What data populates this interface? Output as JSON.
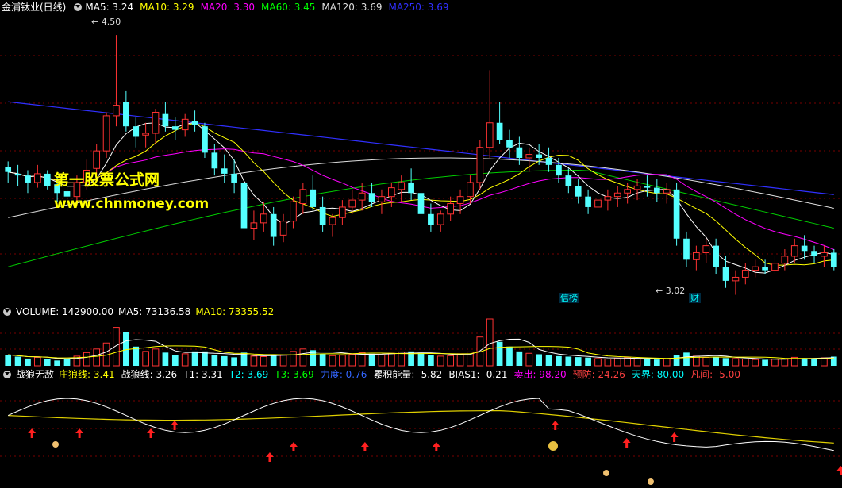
{
  "price_header": {
    "title": "金浦钛业(日线)",
    "ma": [
      {
        "label": "MA5: 3.24",
        "color": "#ffffff"
      },
      {
        "label": "MA10: 3.29",
        "color": "#ffff00"
      },
      {
        "label": "MA20: 3.30",
        "color": "#ff00ff"
      },
      {
        "label": "MA60: 3.45",
        "color": "#00ff00"
      },
      {
        "label": "MA120: 3.69",
        "color": "#dddddd"
      },
      {
        "label": "MA250: 3.69",
        "color": "#3030ff"
      }
    ]
  },
  "annotations": {
    "high": "4.50",
    "low": "3.02",
    "tag1": "信榜",
    "tag2": "财"
  },
  "watermark": {
    "line1": "第一股票公式网",
    "line2": "www.chnmoney.com"
  },
  "volume_header": {
    "label": "VOLUME: 142900.00",
    "ma5": "MA5: 73136.58",
    "ma10": "MA10: 73355.52"
  },
  "indicator_header": {
    "name": "战狼无敌",
    "items": [
      {
        "label": "庄狼线: 3.41",
        "color": "#ffff00"
      },
      {
        "label": "战狼线: 3.26",
        "color": "#ffffff"
      },
      {
        "label": "T1: 3.31",
        "color": "#ffffff"
      },
      {
        "label": "T2: 3.69",
        "color": "#00ffff"
      },
      {
        "label": "T3: 3.69",
        "color": "#00ff00"
      },
      {
        "label": "力度: 0.76",
        "color": "#3366ff"
      },
      {
        "label": "累积能量: -5.82",
        "color": "#ffffff"
      },
      {
        "label": "BIAS1: -0.21",
        "color": "#ffffff"
      },
      {
        "label": "卖出: 98.20",
        "color": "#ff00ff"
      },
      {
        "label": "预防: 24.26",
        "color": "#ff4040"
      },
      {
        "label": "天界: 80.00",
        "color": "#00ffff"
      },
      {
        "label": "凡间: -5.00",
        "color": "#ff4040"
      }
    ]
  },
  "colors": {
    "up": "#ff3232",
    "down": "#54ffff",
    "grid": "#7a0000"
  },
  "chart_data": {
    "type": "candlestick",
    "ohlc": [
      [
        3.75,
        3.78,
        3.66,
        3.72
      ],
      [
        3.71,
        3.76,
        3.64,
        3.7
      ],
      [
        3.7,
        3.73,
        3.6,
        3.66
      ],
      [
        3.66,
        3.76,
        3.63,
        3.71
      ],
      [
        3.71,
        3.73,
        3.62,
        3.64
      ],
      [
        3.65,
        3.69,
        3.55,
        3.6
      ],
      [
        3.61,
        3.64,
        3.5,
        3.58
      ],
      [
        3.58,
        3.7,
        3.55,
        3.66
      ],
      [
        3.66,
        3.79,
        3.62,
        3.73
      ],
      [
        3.74,
        3.88,
        3.7,
        3.84
      ],
      [
        3.84,
        4.06,
        3.8,
        4.04
      ],
      [
        4.04,
        4.5,
        3.98,
        4.1
      ],
      [
        4.12,
        4.18,
        3.95,
        3.98
      ],
      [
        3.98,
        4.03,
        3.86,
        3.92
      ],
      [
        3.93,
        4.0,
        3.86,
        3.94
      ],
      [
        3.94,
        4.08,
        3.88,
        4.06
      ],
      [
        4.05,
        4.12,
        3.95,
        3.98
      ],
      [
        3.98,
        4.03,
        3.9,
        3.96
      ],
      [
        3.96,
        4.05,
        3.92,
        4.02
      ],
      [
        4.01,
        4.07,
        3.95,
        3.99
      ],
      [
        3.98,
        4.0,
        3.8,
        3.83
      ],
      [
        3.83,
        3.88,
        3.7,
        3.74
      ],
      [
        3.74,
        3.82,
        3.66,
        3.71
      ],
      [
        3.71,
        3.79,
        3.6,
        3.66
      ],
      [
        3.66,
        3.7,
        3.35,
        3.4
      ],
      [
        3.4,
        3.5,
        3.33,
        3.43
      ],
      [
        3.43,
        3.55,
        3.38,
        3.48
      ],
      [
        3.48,
        3.52,
        3.3,
        3.35
      ],
      [
        3.36,
        3.48,
        3.32,
        3.44
      ],
      [
        3.44,
        3.58,
        3.4,
        3.55
      ],
      [
        3.54,
        3.66,
        3.48,
        3.62
      ],
      [
        3.62,
        3.7,
        3.5,
        3.52
      ],
      [
        3.52,
        3.58,
        3.38,
        3.42
      ],
      [
        3.42,
        3.48,
        3.35,
        3.46
      ],
      [
        3.46,
        3.56,
        3.42,
        3.52
      ],
      [
        3.52,
        3.62,
        3.48,
        3.56
      ],
      [
        3.56,
        3.66,
        3.5,
        3.6
      ],
      [
        3.6,
        3.66,
        3.52,
        3.55
      ],
      [
        3.55,
        3.62,
        3.48,
        3.58
      ],
      [
        3.58,
        3.66,
        3.52,
        3.63
      ],
      [
        3.62,
        3.7,
        3.55,
        3.66
      ],
      [
        3.66,
        3.74,
        3.56,
        3.6
      ],
      [
        3.6,
        3.66,
        3.45,
        3.48
      ],
      [
        3.48,
        3.54,
        3.38,
        3.42
      ],
      [
        3.42,
        3.5,
        3.38,
        3.48
      ],
      [
        3.48,
        3.58,
        3.44,
        3.54
      ],
      [
        3.54,
        3.62,
        3.48,
        3.58
      ],
      [
        3.58,
        3.7,
        3.54,
        3.66
      ],
      [
        3.66,
        3.9,
        3.62,
        3.86
      ],
      [
        3.86,
        4.3,
        3.8,
        4.0
      ],
      [
        4.0,
        4.12,
        3.88,
        3.9
      ],
      [
        3.9,
        3.96,
        3.8,
        3.86
      ],
      [
        3.86,
        3.92,
        3.76,
        3.8
      ],
      [
        3.8,
        3.86,
        3.72,
        3.82
      ],
      [
        3.82,
        3.88,
        3.76,
        3.8
      ],
      [
        3.8,
        3.86,
        3.72,
        3.76
      ],
      [
        3.76,
        3.8,
        3.66,
        3.7
      ],
      [
        3.7,
        3.74,
        3.6,
        3.64
      ],
      [
        3.64,
        3.68,
        3.54,
        3.58
      ],
      [
        3.58,
        3.62,
        3.48,
        3.52
      ],
      [
        3.52,
        3.58,
        3.46,
        3.56
      ],
      [
        3.56,
        3.62,
        3.5,
        3.58
      ],
      [
        3.58,
        3.64,
        3.52,
        3.6
      ],
      [
        3.6,
        3.66,
        3.54,
        3.62
      ],
      [
        3.62,
        3.68,
        3.56,
        3.64
      ],
      [
        3.64,
        3.7,
        3.58,
        3.63
      ],
      [
        3.63,
        3.68,
        3.55,
        3.6
      ],
      [
        3.6,
        3.66,
        3.54,
        3.62
      ],
      [
        3.62,
        3.66,
        3.3,
        3.34
      ],
      [
        3.34,
        3.38,
        3.18,
        3.22
      ],
      [
        3.22,
        3.3,
        3.16,
        3.26
      ],
      [
        3.26,
        3.34,
        3.2,
        3.3
      ],
      [
        3.3,
        3.34,
        3.14,
        3.18
      ],
      [
        3.18,
        3.24,
        3.06,
        3.1
      ],
      [
        3.1,
        3.16,
        3.02,
        3.12
      ],
      [
        3.12,
        3.2,
        3.08,
        3.16
      ],
      [
        3.16,
        3.22,
        3.12,
        3.18
      ],
      [
        3.18,
        3.22,
        3.14,
        3.16
      ],
      [
        3.16,
        3.24,
        3.14,
        3.2
      ],
      [
        3.2,
        3.28,
        3.16,
        3.24
      ],
      [
        3.24,
        3.34,
        3.2,
        3.3
      ],
      [
        3.3,
        3.36,
        3.22,
        3.27
      ],
      [
        3.27,
        3.3,
        3.2,
        3.24
      ],
      [
        3.24,
        3.3,
        3.18,
        3.26
      ],
      [
        3.26,
        3.28,
        3.16,
        3.18
      ]
    ],
    "volume": [
      46,
      38,
      30,
      35,
      28,
      22,
      30,
      40,
      55,
      70,
      95,
      160,
      140,
      80,
      60,
      70,
      55,
      45,
      50,
      60,
      60,
      45,
      40,
      35,
      55,
      40,
      38,
      42,
      44,
      60,
      70,
      65,
      50,
      42,
      44,
      48,
      55,
      50,
      45,
      52,
      58,
      60,
      55,
      45,
      40,
      42,
      50,
      58,
      120,
      195,
      100,
      80,
      60,
      52,
      48,
      45,
      40,
      38,
      36,
      34,
      30,
      28,
      32,
      35,
      30,
      28,
      26,
      30,
      45,
      55,
      40,
      35,
      38,
      32,
      30,
      28,
      26,
      25,
      28,
      30,
      35,
      32,
      30,
      33,
      38
    ],
    "ylim_price": [
      3.0,
      4.6
    ]
  }
}
